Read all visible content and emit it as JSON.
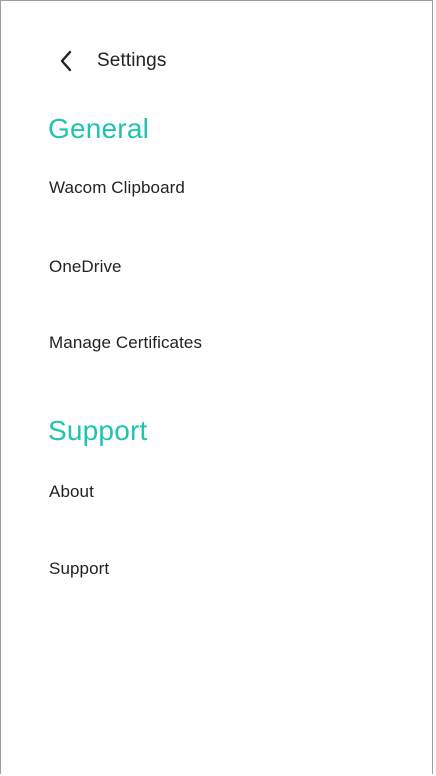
{
  "header": {
    "title": "Settings"
  },
  "sections": [
    {
      "heading": "General",
      "items": [
        {
          "label": "Wacom Clipboard"
        },
        {
          "label": "OneDrive"
        },
        {
          "label": "Manage Certificates"
        }
      ]
    },
    {
      "heading": "Support",
      "items": [
        {
          "label": "About"
        },
        {
          "label": "Support"
        }
      ]
    }
  ],
  "colors": {
    "accent": "#1fc4b1",
    "text": "#222222",
    "border": "#9e9e9e"
  }
}
